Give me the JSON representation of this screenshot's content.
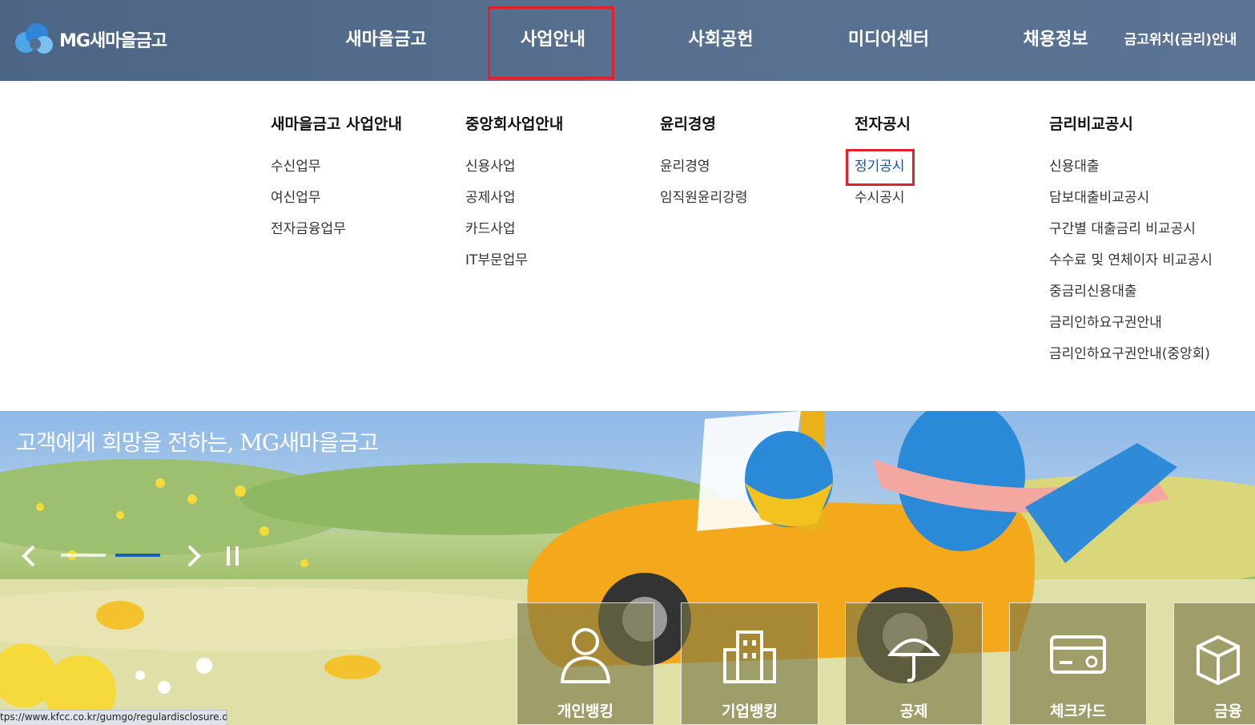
{
  "header": {
    "logo_text": "MG새마을금고",
    "nav": [
      "새마을금고",
      "사업안내",
      "사회공헌",
      "미디어센터",
      "채용정보",
      "금고위치(금리)안내"
    ]
  },
  "mega_menu": {
    "columns": [
      {
        "title": "새마을금고 사업안내",
        "items": [
          "수신업무",
          "여신업무",
          "전자금융업무"
        ]
      },
      {
        "title": "중앙회사업안내",
        "items": [
          "신용사업",
          "공제사업",
          "카드사업",
          "IT부문업무"
        ]
      },
      {
        "title": "윤리경영",
        "items": [
          "윤리경영",
          "임직원윤리강령"
        ]
      },
      {
        "title": "전자공시",
        "items": [
          "정기공시",
          "수시공시"
        ]
      },
      {
        "title": "금리비교공시",
        "items": [
          "신용대출",
          "담보대출비교공시",
          "구간별 대출금리 비교공시",
          "수수료 및 연체이자 비교공시",
          "중금리신용대출",
          "금리인하요구권안내",
          "금리인하요구권안내(중앙회)"
        ]
      }
    ],
    "active_item": "정기공시"
  },
  "banner": {
    "slogan": "고객에게 희망을 전하는, MG새마을금고",
    "carousel_progress": {
      "current": 2,
      "total": 2
    }
  },
  "quick_menu": [
    "개인뱅킹",
    "기업뱅킹",
    "공제",
    "체크카드",
    "금융상"
  ],
  "status_url": "tps://www.kfcc.co.kr/gumgo/regulardisclosure.do",
  "colors": {
    "header_bg": "#56708f",
    "highlight": "#e0202a",
    "active_link": "#1a4fa0"
  }
}
